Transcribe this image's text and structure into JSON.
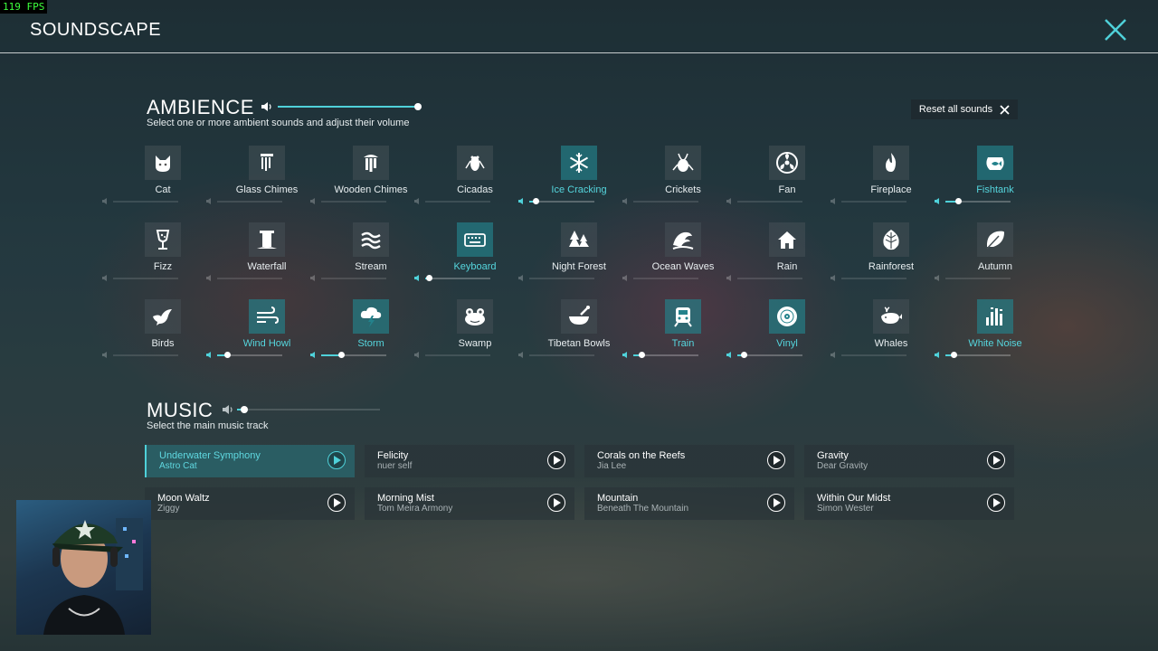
{
  "fps": "119 FPS",
  "app": {
    "title": "SOUNDSCAPE"
  },
  "ambience": {
    "title": "AMBIENCE",
    "subtitle": "Select one or more ambient sounds and adjust their volume",
    "master_volume": 1.0,
    "reset_label": "Reset all sounds",
    "sounds": [
      {
        "label": "Cat",
        "icon": "cat-icon",
        "active": false,
        "volume": 0
      },
      {
        "label": "Glass Chimes",
        "icon": "glass-chimes-icon",
        "active": false,
        "volume": 0
      },
      {
        "label": "Wooden Chimes",
        "icon": "wooden-chimes-icon",
        "active": false,
        "volume": 0
      },
      {
        "label": "Cicadas",
        "icon": "cicada-icon",
        "active": false,
        "volume": 0
      },
      {
        "label": "Ice Cracking",
        "icon": "snowflake-icon",
        "active": true,
        "volume": 0.1
      },
      {
        "label": "Crickets",
        "icon": "cricket-icon",
        "active": false,
        "volume": 0
      },
      {
        "label": "Fan",
        "icon": "fan-icon",
        "active": false,
        "volume": 0
      },
      {
        "label": "Fireplace",
        "icon": "fire-icon",
        "active": false,
        "volume": 0
      },
      {
        "label": "Fishtank",
        "icon": "fishbowl-icon",
        "active": true,
        "volume": 0.2
      },
      {
        "label": "Fizz",
        "icon": "glass-fizz-icon",
        "active": false,
        "volume": 0
      },
      {
        "label": "Waterfall",
        "icon": "waterfall-icon",
        "active": false,
        "volume": 0
      },
      {
        "label": "Stream",
        "icon": "stream-icon",
        "active": false,
        "volume": 0
      },
      {
        "label": "Keyboard",
        "icon": "keyboard-icon",
        "active": true,
        "volume": 0.05
      },
      {
        "label": "Night Forest",
        "icon": "forest-icon",
        "active": false,
        "volume": 0
      },
      {
        "label": "Ocean Waves",
        "icon": "wave-icon",
        "active": false,
        "volume": 0
      },
      {
        "label": "Rain",
        "icon": "house-rain-icon",
        "active": false,
        "volume": 0
      },
      {
        "label": "Rainforest",
        "icon": "leaf-icon",
        "active": false,
        "volume": 0
      },
      {
        "label": "Autumn",
        "icon": "autumn-leaf-icon",
        "active": false,
        "volume": 0
      },
      {
        "label": "Birds",
        "icon": "bird-icon",
        "active": false,
        "volume": 0
      },
      {
        "label": "Wind Howl",
        "icon": "wind-icon",
        "active": true,
        "volume": 0.15
      },
      {
        "label": "Storm",
        "icon": "storm-icon",
        "active": true,
        "volume": 0.3
      },
      {
        "label": "Swamp",
        "icon": "frog-icon",
        "active": false,
        "volume": 0
      },
      {
        "label": "Tibetan Bowls",
        "icon": "bowl-icon",
        "active": false,
        "volume": 0
      },
      {
        "label": "Train",
        "icon": "train-icon",
        "active": true,
        "volume": 0.12
      },
      {
        "label": "Vinyl",
        "icon": "vinyl-icon",
        "active": true,
        "volume": 0.1
      },
      {
        "label": "Whales",
        "icon": "whale-icon",
        "active": false,
        "volume": 0
      },
      {
        "label": "White Noise",
        "icon": "equalizer-icon",
        "active": true,
        "volume": 0.12
      }
    ]
  },
  "music": {
    "title": "MUSIC",
    "subtitle": "Select the main music track",
    "master_volume": 0.05,
    "tracks": [
      {
        "name": "Underwater Symphony",
        "artist": "Astro Cat",
        "active": true
      },
      {
        "name": "Felicity",
        "artist": "nuer self",
        "active": false
      },
      {
        "name": "Corals on the Reefs",
        "artist": "Jia Lee",
        "active": false
      },
      {
        "name": "Gravity",
        "artist": "Dear Gravity",
        "active": false
      },
      {
        "name": "Moon Waltz",
        "artist": "Ziggy",
        "active": false
      },
      {
        "name": "Morning Mist",
        "artist": "Tom Meira Armony",
        "active": false
      },
      {
        "name": "Mountain",
        "artist": "Beneath The Mountain",
        "active": false
      },
      {
        "name": "Within Our Midst",
        "artist": "Simon Wester",
        "active": false
      }
    ]
  },
  "colors": {
    "accent": "#4fd1d9",
    "active_tile": "#23828c",
    "tile": "#465055"
  }
}
